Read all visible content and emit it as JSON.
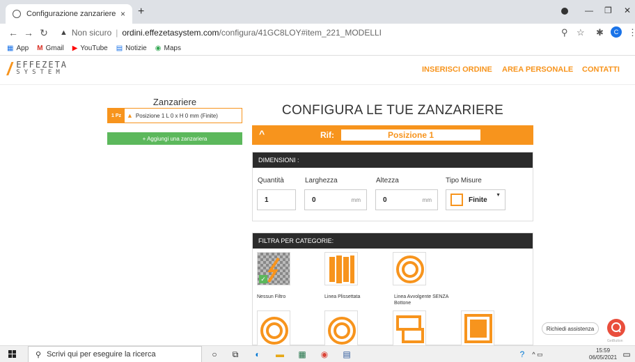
{
  "browser": {
    "tab_title": "Configurazione zanzariere",
    "tab_close": "×",
    "new_tab": "+",
    "security_label": "Non sicuro",
    "url_host": "ordini.effezetasystem.com",
    "url_path": "/configura/41GC8LOY#item_221_MODELLI",
    "profile_initial": "C",
    "bookmarks": [
      {
        "label": "App",
        "icon": "apps-grid-icon"
      },
      {
        "label": "Gmail",
        "icon": "gmail-icon"
      },
      {
        "label": "YouTube",
        "icon": "youtube-icon"
      },
      {
        "label": "Notizie",
        "icon": "news-icon"
      },
      {
        "label": "Maps",
        "icon": "maps-pin-icon"
      }
    ]
  },
  "site": {
    "logo_line1": "EFFEZETA",
    "logo_line2": "SYSTEM",
    "menu": [
      "INSERISCI ORDINE",
      "AREA PERSONALE",
      "CONTATTI"
    ]
  },
  "left": {
    "title": "Zanzariere",
    "position_qty": "1 Pz",
    "position_text": "Posizione 1 L 0 x H 0 mm (Finite)",
    "add_button": "+ Aggiungi una zanzariera"
  },
  "config": {
    "title": "CONFIGURA LE TUE ZANZARIERE",
    "rif_label": "Rif:",
    "rif_value": "Posizione 1",
    "dimensions_header": "DIMENSIONI :",
    "labels": {
      "quantita": "Quantità",
      "larghezza": "Larghezza",
      "altezza": "Altezza",
      "tipo": "Tipo Misure"
    },
    "values": {
      "quantita": "1",
      "larghezza": "0",
      "altezza": "0",
      "tipo": "Finite"
    },
    "unit": "mm",
    "filter_header": "FILTRA PER CATEGORIE:",
    "categories": [
      {
        "label": "Nessun Filtro",
        "selected": true
      },
      {
        "label": "Linea Plissettata",
        "selected": false
      },
      {
        "label": "Linea Avvolgente SENZA Bottone",
        "selected": false
      }
    ]
  },
  "assist": {
    "label": "Richiedi assistenza",
    "brand": "GetButton"
  },
  "taskbar": {
    "search_placeholder": "Scrivi qui per eseguire la ricerca",
    "time": "15:59",
    "date": "06/05/2021"
  },
  "colors": {
    "accent": "#f7941d",
    "success": "#5cb85c",
    "dark": "#2b2b2b"
  }
}
